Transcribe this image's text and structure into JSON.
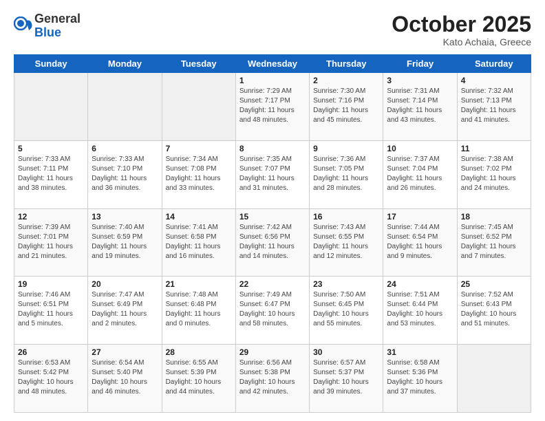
{
  "header": {
    "logo_general": "General",
    "logo_blue": "Blue",
    "month": "October 2025",
    "location": "Kato Achaia, Greece"
  },
  "days_of_week": [
    "Sunday",
    "Monday",
    "Tuesday",
    "Wednesday",
    "Thursday",
    "Friday",
    "Saturday"
  ],
  "weeks": [
    [
      {
        "day": "",
        "sunrise": "",
        "sunset": "",
        "daylight": ""
      },
      {
        "day": "",
        "sunrise": "",
        "sunset": "",
        "daylight": ""
      },
      {
        "day": "",
        "sunrise": "",
        "sunset": "",
        "daylight": ""
      },
      {
        "day": "1",
        "sunrise": "Sunrise: 7:29 AM",
        "sunset": "Sunset: 7:17 PM",
        "daylight": "Daylight: 11 hours and 48 minutes."
      },
      {
        "day": "2",
        "sunrise": "Sunrise: 7:30 AM",
        "sunset": "Sunset: 7:16 PM",
        "daylight": "Daylight: 11 hours and 45 minutes."
      },
      {
        "day": "3",
        "sunrise": "Sunrise: 7:31 AM",
        "sunset": "Sunset: 7:14 PM",
        "daylight": "Daylight: 11 hours and 43 minutes."
      },
      {
        "day": "4",
        "sunrise": "Sunrise: 7:32 AM",
        "sunset": "Sunset: 7:13 PM",
        "daylight": "Daylight: 11 hours and 41 minutes."
      }
    ],
    [
      {
        "day": "5",
        "sunrise": "Sunrise: 7:33 AM",
        "sunset": "Sunset: 7:11 PM",
        "daylight": "Daylight: 11 hours and 38 minutes."
      },
      {
        "day": "6",
        "sunrise": "Sunrise: 7:33 AM",
        "sunset": "Sunset: 7:10 PM",
        "daylight": "Daylight: 11 hours and 36 minutes."
      },
      {
        "day": "7",
        "sunrise": "Sunrise: 7:34 AM",
        "sunset": "Sunset: 7:08 PM",
        "daylight": "Daylight: 11 hours and 33 minutes."
      },
      {
        "day": "8",
        "sunrise": "Sunrise: 7:35 AM",
        "sunset": "Sunset: 7:07 PM",
        "daylight": "Daylight: 11 hours and 31 minutes."
      },
      {
        "day": "9",
        "sunrise": "Sunrise: 7:36 AM",
        "sunset": "Sunset: 7:05 PM",
        "daylight": "Daylight: 11 hours and 28 minutes."
      },
      {
        "day": "10",
        "sunrise": "Sunrise: 7:37 AM",
        "sunset": "Sunset: 7:04 PM",
        "daylight": "Daylight: 11 hours and 26 minutes."
      },
      {
        "day": "11",
        "sunrise": "Sunrise: 7:38 AM",
        "sunset": "Sunset: 7:02 PM",
        "daylight": "Daylight: 11 hours and 24 minutes."
      }
    ],
    [
      {
        "day": "12",
        "sunrise": "Sunrise: 7:39 AM",
        "sunset": "Sunset: 7:01 PM",
        "daylight": "Daylight: 11 hours and 21 minutes."
      },
      {
        "day": "13",
        "sunrise": "Sunrise: 7:40 AM",
        "sunset": "Sunset: 6:59 PM",
        "daylight": "Daylight: 11 hours and 19 minutes."
      },
      {
        "day": "14",
        "sunrise": "Sunrise: 7:41 AM",
        "sunset": "Sunset: 6:58 PM",
        "daylight": "Daylight: 11 hours and 16 minutes."
      },
      {
        "day": "15",
        "sunrise": "Sunrise: 7:42 AM",
        "sunset": "Sunset: 6:56 PM",
        "daylight": "Daylight: 11 hours and 14 minutes."
      },
      {
        "day": "16",
        "sunrise": "Sunrise: 7:43 AM",
        "sunset": "Sunset: 6:55 PM",
        "daylight": "Daylight: 11 hours and 12 minutes."
      },
      {
        "day": "17",
        "sunrise": "Sunrise: 7:44 AM",
        "sunset": "Sunset: 6:54 PM",
        "daylight": "Daylight: 11 hours and 9 minutes."
      },
      {
        "day": "18",
        "sunrise": "Sunrise: 7:45 AM",
        "sunset": "Sunset: 6:52 PM",
        "daylight": "Daylight: 11 hours and 7 minutes."
      }
    ],
    [
      {
        "day": "19",
        "sunrise": "Sunrise: 7:46 AM",
        "sunset": "Sunset: 6:51 PM",
        "daylight": "Daylight: 11 hours and 5 minutes."
      },
      {
        "day": "20",
        "sunrise": "Sunrise: 7:47 AM",
        "sunset": "Sunset: 6:49 PM",
        "daylight": "Daylight: 11 hours and 2 minutes."
      },
      {
        "day": "21",
        "sunrise": "Sunrise: 7:48 AM",
        "sunset": "Sunset: 6:48 PM",
        "daylight": "Daylight: 11 hours and 0 minutes."
      },
      {
        "day": "22",
        "sunrise": "Sunrise: 7:49 AM",
        "sunset": "Sunset: 6:47 PM",
        "daylight": "Daylight: 10 hours and 58 minutes."
      },
      {
        "day": "23",
        "sunrise": "Sunrise: 7:50 AM",
        "sunset": "Sunset: 6:45 PM",
        "daylight": "Daylight: 10 hours and 55 minutes."
      },
      {
        "day": "24",
        "sunrise": "Sunrise: 7:51 AM",
        "sunset": "Sunset: 6:44 PM",
        "daylight": "Daylight: 10 hours and 53 minutes."
      },
      {
        "day": "25",
        "sunrise": "Sunrise: 7:52 AM",
        "sunset": "Sunset: 6:43 PM",
        "daylight": "Daylight: 10 hours and 51 minutes."
      }
    ],
    [
      {
        "day": "26",
        "sunrise": "Sunrise: 6:53 AM",
        "sunset": "Sunset: 5:42 PM",
        "daylight": "Daylight: 10 hours and 48 minutes."
      },
      {
        "day": "27",
        "sunrise": "Sunrise: 6:54 AM",
        "sunset": "Sunset: 5:40 PM",
        "daylight": "Daylight: 10 hours and 46 minutes."
      },
      {
        "day": "28",
        "sunrise": "Sunrise: 6:55 AM",
        "sunset": "Sunset: 5:39 PM",
        "daylight": "Daylight: 10 hours and 44 minutes."
      },
      {
        "day": "29",
        "sunrise": "Sunrise: 6:56 AM",
        "sunset": "Sunset: 5:38 PM",
        "daylight": "Daylight: 10 hours and 42 minutes."
      },
      {
        "day": "30",
        "sunrise": "Sunrise: 6:57 AM",
        "sunset": "Sunset: 5:37 PM",
        "daylight": "Daylight: 10 hours and 39 minutes."
      },
      {
        "day": "31",
        "sunrise": "Sunrise: 6:58 AM",
        "sunset": "Sunset: 5:36 PM",
        "daylight": "Daylight: 10 hours and 37 minutes."
      },
      {
        "day": "",
        "sunrise": "",
        "sunset": "",
        "daylight": ""
      }
    ]
  ]
}
